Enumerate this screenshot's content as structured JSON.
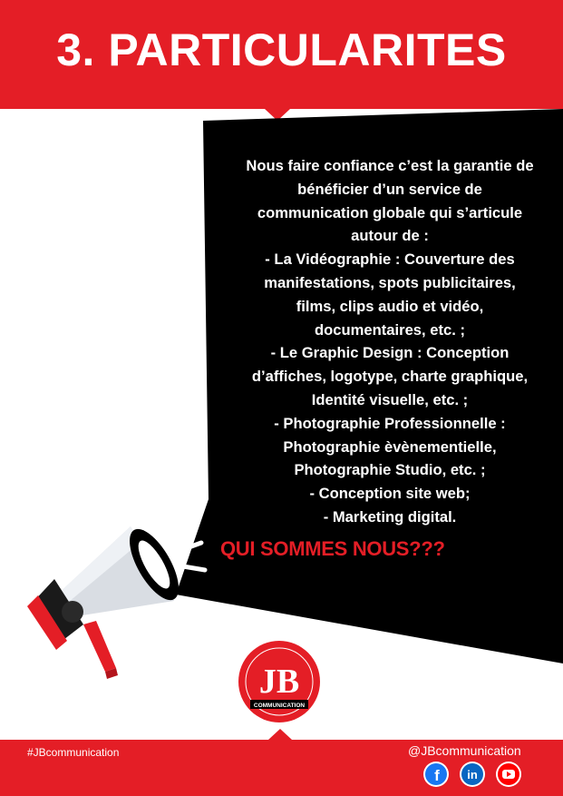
{
  "header": {
    "title": "3. PARTICULARITES"
  },
  "body": {
    "lines": [
      "Nous faire confiance c’est la garantie de",
      "bénéficier d’un service de",
      "communication globale qui s’articule",
      "autour de :",
      "- La Vidéographie : Couverture des",
      "manifestations, spots publicitaires,",
      "films, clips audio et vidéo,",
      "documentaires, etc. ;",
      "- Le Graphic Design : Conception",
      "d’affiches, logotype, charte graphique,",
      "Identité visuelle, etc. ;",
      "- Photographie Professionnelle :",
      "Photographie èvènementielle,",
      "Photographie Studio, etc. ;",
      "- Conception site web;",
      "- Marketing digital."
    ]
  },
  "cta": "QUI SOMMES NOUS???",
  "logo": {
    "letters": "JB",
    "caption": "COMMUNICATION"
  },
  "footer": {
    "hashtag": "#JBcommunication",
    "handle": "@JBcommunication"
  },
  "social": [
    {
      "icon": "facebook-icon",
      "glyph": "f",
      "color": "#1877f2"
    },
    {
      "icon": "linkedin-icon",
      "glyph": "in",
      "color": "#0a66c2"
    },
    {
      "icon": "youtube-icon",
      "glyph": "",
      "color": "#ff0000"
    }
  ],
  "colors": {
    "brand_red": "#e41e26",
    "black": "#000000",
    "white": "#ffffff"
  }
}
